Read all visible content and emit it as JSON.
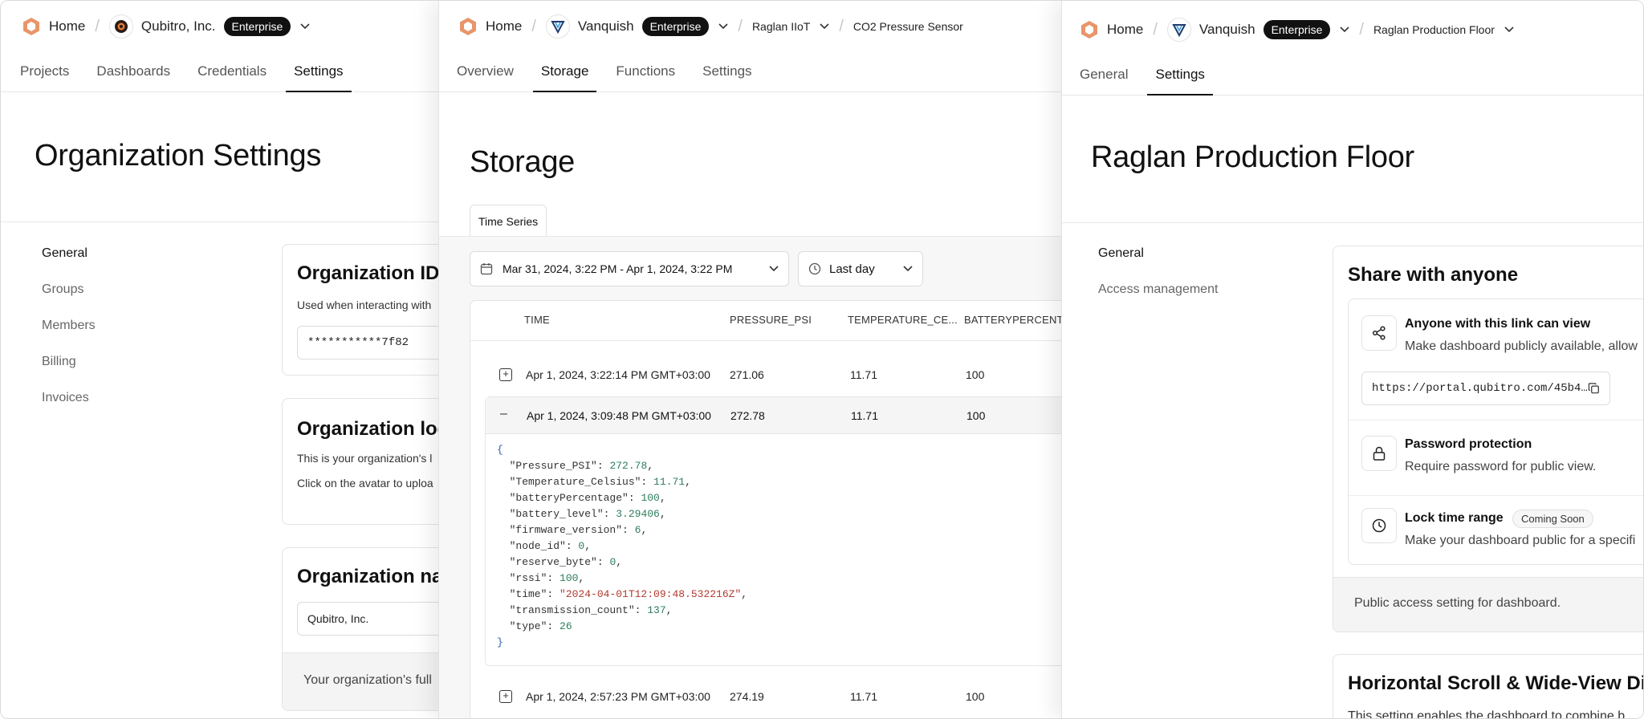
{
  "panel_left": {
    "breadcrumb": {
      "home": "Home",
      "org": "Qubitro, Inc.",
      "badge": "Enterprise"
    },
    "tabs": [
      "Projects",
      "Dashboards",
      "Credentials",
      "Settings"
    ],
    "title": "Organization Settings",
    "sidebar": [
      "General",
      "Groups",
      "Members",
      "Billing",
      "Invoices"
    ],
    "org_id_card": {
      "title": "Organization ID",
      "desc": "Used when interacting with",
      "value": "***********7f82"
    },
    "logo_card": {
      "title": "Organization log",
      "line1": "This is your organization's l",
      "line2": "Click on the avatar to uploa"
    },
    "name_card": {
      "title": "Organization nar",
      "value": "Qubitro, Inc.",
      "footer": "Your organization's full"
    }
  },
  "panel_middle": {
    "breadcrumb": {
      "home": "Home",
      "org": "Vanquish",
      "badge": "Enterprise",
      "project": "Raglan IIoT",
      "device": "CO2 Pressure Sensor"
    },
    "tabs": [
      "Overview",
      "Storage",
      "Functions",
      "Settings"
    ],
    "title": "Storage",
    "subtab": "Time Series",
    "date_range": "Mar 31, 2024, 3:22 PM - Apr 1, 2024, 3:22 PM",
    "period": "Last day",
    "columns": [
      "TIME",
      "PRESSURE_PSI",
      "TEMPERATURE_CE...",
      "BATTERYPERCENT..."
    ],
    "rows": [
      {
        "time": "Apr 1, 2024, 3:22:14 PM GMT+03:00",
        "pressure": "271.06",
        "temperature": "11.71",
        "battery": "100"
      },
      {
        "time": "Apr 1, 2024, 3:09:48 PM GMT+03:00",
        "pressure": "272.78",
        "temperature": "11.71",
        "battery": "100"
      },
      {
        "time": "Apr 1, 2024, 2:57:23 PM GMT+03:00",
        "pressure": "274.19",
        "temperature": "11.71",
        "battery": "100"
      }
    ],
    "json": [
      {
        "key": "\"Pressure_PSI\"",
        "value": "272.78",
        "kind": "n"
      },
      {
        "key": "\"Temperature_Celsius\"",
        "value": "11.71",
        "kind": "n"
      },
      {
        "key": "\"batteryPercentage\"",
        "value": "100",
        "kind": "n"
      },
      {
        "key": "\"battery_level\"",
        "value": "3.29406",
        "kind": "n"
      },
      {
        "key": "\"firmware_version\"",
        "value": "6",
        "kind": "n"
      },
      {
        "key": "\"node_id\"",
        "value": "0",
        "kind": "n"
      },
      {
        "key": "\"reserve_byte\"",
        "value": "0",
        "kind": "n"
      },
      {
        "key": "\"rssi\"",
        "value": "100",
        "kind": "n"
      },
      {
        "key": "\"time\"",
        "value": "\"2024-04-01T12:09:48.532216Z\"",
        "kind": "s"
      },
      {
        "key": "\"transmission_count\"",
        "value": "137",
        "kind": "n"
      },
      {
        "key": "\"type\"",
        "value": "26",
        "kind": "n"
      }
    ]
  },
  "panel_right": {
    "breadcrumb": {
      "home": "Home",
      "org": "Vanquish",
      "badge": "Enterprise",
      "dashboard": "Raglan Production Floor"
    },
    "tabs": [
      "General",
      "Settings"
    ],
    "title": "Raglan Production Floor",
    "sidebar": [
      "General",
      "Access management"
    ],
    "share_card": {
      "title": "Share with anyone",
      "link_title": "Anyone with this link can view",
      "link_desc": "Make dashboard publicly available, allow",
      "url": "https://portal.qubitro.com/45b4…",
      "password_title": "Password protection",
      "password_desc": "Require password for public view.",
      "lock_title": "Lock time range",
      "lock_badge": "Coming Soon",
      "lock_desc": "Make your dashboard public for a specifi",
      "footer": "Public access setting for dashboard."
    },
    "scroll_card": {
      "title": "Horizontal Scroll & Wide-View Disp",
      "desc": "This setting enables the dashboard to combine b"
    }
  },
  "colors": {
    "brand_orange": "#e8956a",
    "accent_dark": "#111111",
    "json_number": "#2e7d5b",
    "json_string": "#b03a2e"
  }
}
